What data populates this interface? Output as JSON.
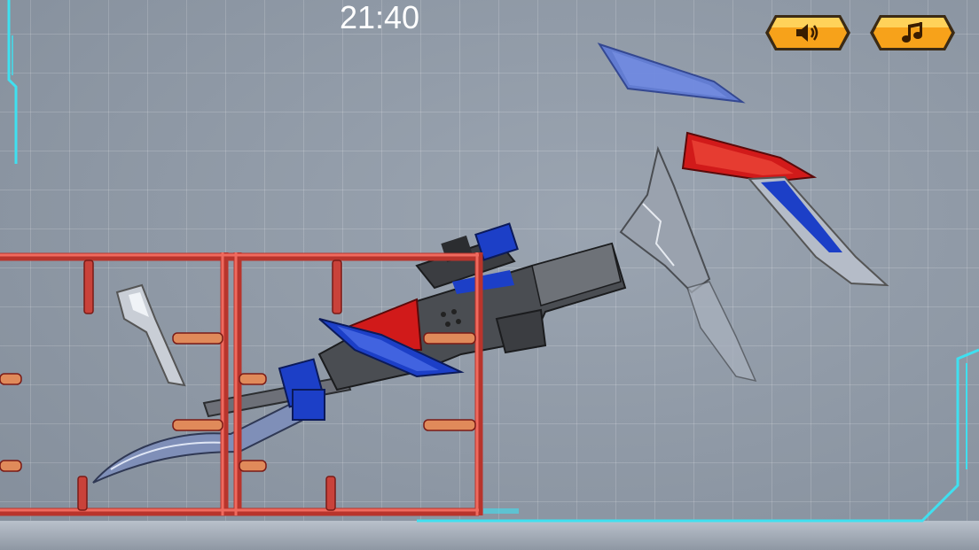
{
  "hud": {
    "timer": "21:40",
    "sound_button": {
      "icon": "speaker-icon"
    },
    "music_button": {
      "icon": "music-note-icon"
    }
  },
  "colors": {
    "background": "#8f9aa8",
    "frame_red": "#d8473c",
    "button_orange": "#f7a21a",
    "part_blue": "#1c3fc7",
    "part_red": "#d11a1a",
    "part_gray": "#4a4d52",
    "hud_cyan": "#3fe0f0"
  }
}
